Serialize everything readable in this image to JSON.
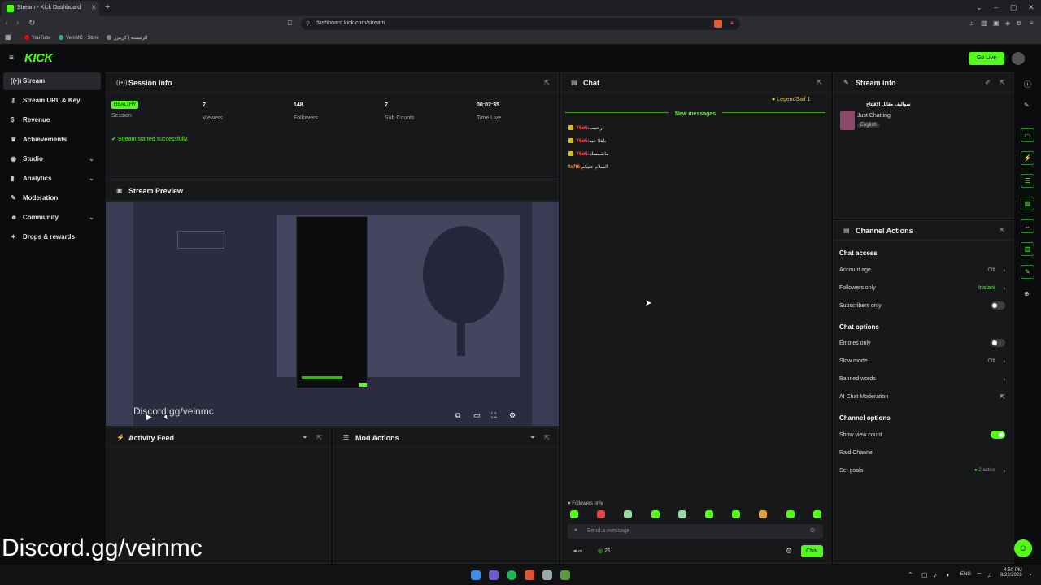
{
  "browser": {
    "tab_title": "Stream - Kick Dashboard",
    "url": "dashboard.kick.com/stream",
    "bookmarks": [
      "YouTube",
      "VeinMC - Store",
      "الرئيسية | كرينزر"
    ]
  },
  "app": {
    "logo": "KICK",
    "go_live_label": "Go Live"
  },
  "sidebar": {
    "items": [
      {
        "label": "Stream",
        "icon": "signal-icon"
      },
      {
        "label": "Stream URL & Key",
        "icon": "key-icon"
      },
      {
        "label": "Revenue",
        "icon": "dollar-icon"
      },
      {
        "label": "Achievements",
        "icon": "trophy-icon"
      },
      {
        "label": "Studio",
        "icon": "studio-icon"
      },
      {
        "label": "Analytics",
        "icon": "chart-icon"
      },
      {
        "label": "Moderation",
        "icon": "wrench-icon"
      },
      {
        "label": "Community",
        "icon": "people-icon"
      },
      {
        "label": "Drops & rewards",
        "icon": "gift-icon"
      }
    ]
  },
  "session": {
    "title": "Session Info",
    "status": "HEALTHY",
    "status_label": "Session",
    "stats": [
      {
        "value": "7",
        "label": "Viewers"
      },
      {
        "value": "148",
        "label": "Followers"
      },
      {
        "value": "7",
        "label": "Sub Counts"
      },
      {
        "value": "00:02:35",
        "label": "Time Live"
      }
    ],
    "notice": "Stream started successfully."
  },
  "preview": {
    "title": "Stream Preview",
    "overlay_text": "Discord.gg/veinmc"
  },
  "activity": {
    "title": "Activity Feed"
  },
  "mod_actions": {
    "title": "Mod Actions"
  },
  "chat": {
    "title": "Chat",
    "pinned_user": "LegendSaif",
    "pinned_count": "1",
    "new_messages": "New messages",
    "messages": [
      {
        "user": "Y5o5:",
        "text": "ارحبيب"
      },
      {
        "user": "Y5o5:",
        "text": "ياهلا حيه"
      },
      {
        "user": "Y5o5:",
        "text": "ماشمسك"
      },
      {
        "user": "fx7f6:",
        "text": "السلام عليكم"
      }
    ],
    "mode_label": "Followers only",
    "input_placeholder": "Send a message",
    "viewer_count": "21",
    "send_label": "Chat"
  },
  "stream_info": {
    "title": "Stream info",
    "stream_title": "سواليف مقابل الافتتاح",
    "category": "Just Chatting",
    "language": "English"
  },
  "channel_actions": {
    "title": "Channel Actions",
    "chat_access": {
      "title": "Chat access",
      "account_age_label": "Account age",
      "account_age_value": "Off",
      "followers_only_label": "Followers only",
      "followers_only_value": "Instant",
      "subscribers_only_label": "Subscribers only"
    },
    "chat_options": {
      "title": "Chat options",
      "emotes_only_label": "Emotes only",
      "slow_mode_label": "Slow mode",
      "slow_mode_value": "Off",
      "banned_words_label": "Banned words",
      "ai_moderation_label": "AI Chat Moderation"
    },
    "channel_options": {
      "title": "Channel options",
      "show_view_count_label": "Show view count",
      "raid_channel_label": "Raid Channel",
      "set_goals_label": "Set goals",
      "goals_value": "2 active"
    }
  },
  "taskbar": {
    "language": "ENG",
    "time": "4:50 PM",
    "date": "8/22/2026"
  },
  "watermark": "Discord.gg/veinmc",
  "colors": {
    "accent": "#53fc18",
    "panel": "#17181a",
    "background": "#0b0c0d",
    "alert": "#ff5a5a"
  }
}
